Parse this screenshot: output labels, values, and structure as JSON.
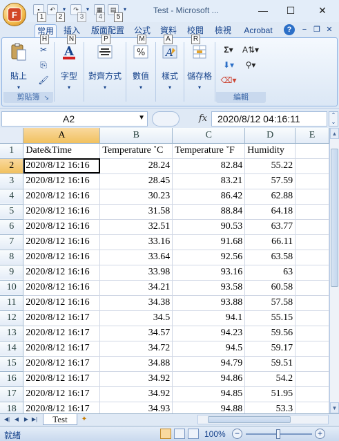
{
  "window": {
    "title": "Test - Microsoft ...",
    "office_button_letter": "F",
    "minimize": "—",
    "maximize": "☐",
    "close": "✕"
  },
  "qat_keytips": [
    "1",
    "2",
    "3",
    "4",
    "5"
  ],
  "ribbon_tabs": [
    {
      "label": "常用",
      "keytip": "H",
      "active": true
    },
    {
      "label": "插入",
      "keytip": "N",
      "active": false
    },
    {
      "label": "版面配置",
      "keytip": "P",
      "active": false
    },
    {
      "label": "公式",
      "keytip": "M",
      "active": false
    },
    {
      "label": "資料",
      "keytip": "A",
      "active": false
    },
    {
      "label": "校閱",
      "keytip": "R",
      "active": false
    },
    {
      "label": "檢視",
      "keytip": "",
      "active": false
    },
    {
      "label": "Acrobat",
      "keytip": "",
      "active": false
    }
  ],
  "ribbon": {
    "groups": {
      "clipboard": {
        "label": "剪貼簿",
        "paste_label": "貼上"
      },
      "font": {
        "label": "字型"
      },
      "alignment": {
        "label": "對齊方式"
      },
      "number": {
        "label": "數值"
      },
      "styles": {
        "label": "樣式"
      },
      "cells": {
        "label": "儲存格"
      },
      "editing": {
        "label": "編輯"
      }
    }
  },
  "formula_bar": {
    "name_box": "A2",
    "fx": "fx",
    "formula": "2020/8/12  04:16:11"
  },
  "sheet": {
    "col_headers": [
      "A",
      "B",
      "C",
      "D",
      "E"
    ],
    "selected_col": "A",
    "selected_row": 2,
    "rows": [
      {
        "n": 1,
        "cells": [
          "Date&Time",
          "Temperature ˚C",
          "Temperature ˚F",
          "Humidity",
          ""
        ]
      },
      {
        "n": 2,
        "cells": [
          "2020/8/12 16:16",
          "28.24",
          "82.84",
          "55.22",
          ""
        ]
      },
      {
        "n": 3,
        "cells": [
          "2020/8/12 16:16",
          "28.45",
          "83.21",
          "57.59",
          ""
        ]
      },
      {
        "n": 4,
        "cells": [
          "2020/8/12 16:16",
          "30.23",
          "86.42",
          "62.88",
          ""
        ]
      },
      {
        "n": 5,
        "cells": [
          "2020/8/12 16:16",
          "31.58",
          "88.84",
          "64.18",
          ""
        ]
      },
      {
        "n": 6,
        "cells": [
          "2020/8/12 16:16",
          "32.51",
          "90.53",
          "63.77",
          ""
        ]
      },
      {
        "n": 7,
        "cells": [
          "2020/8/12 16:16",
          "33.16",
          "91.68",
          "66.11",
          ""
        ]
      },
      {
        "n": 8,
        "cells": [
          "2020/8/12 16:16",
          "33.64",
          "92.56",
          "63.58",
          ""
        ]
      },
      {
        "n": 9,
        "cells": [
          "2020/8/12 16:16",
          "33.98",
          "93.16",
          "63",
          ""
        ]
      },
      {
        "n": 10,
        "cells": [
          "2020/8/12 16:16",
          "34.21",
          "93.58",
          "60.58",
          ""
        ]
      },
      {
        "n": 11,
        "cells": [
          "2020/8/12 16:16",
          "34.38",
          "93.88",
          "57.58",
          ""
        ]
      },
      {
        "n": 12,
        "cells": [
          "2020/8/12 16:17",
          "34.5",
          "94.1",
          "55.15",
          ""
        ]
      },
      {
        "n": 13,
        "cells": [
          "2020/8/12 16:17",
          "34.57",
          "94.23",
          "59.56",
          ""
        ]
      },
      {
        "n": 14,
        "cells": [
          "2020/8/12 16:17",
          "34.72",
          "94.5",
          "59.17",
          ""
        ]
      },
      {
        "n": 15,
        "cells": [
          "2020/8/12 16:17",
          "34.88",
          "94.79",
          "59.51",
          ""
        ]
      },
      {
        "n": 16,
        "cells": [
          "2020/8/12 16:17",
          "34.92",
          "94.86",
          "54.2",
          ""
        ]
      },
      {
        "n": 17,
        "cells": [
          "2020/8/12 16:17",
          "34.92",
          "94.85",
          "51.95",
          ""
        ]
      },
      {
        "n": 18,
        "cells": [
          "2020/8/12 16:17",
          "34.93",
          "94.88",
          "53.3",
          ""
        ]
      }
    ]
  },
  "sheet_tabs": {
    "active": "Test"
  },
  "status_bar": {
    "mode": "就緒",
    "zoom": "100%",
    "zoom_minus": "−",
    "zoom_plus": "+"
  },
  "colors": {
    "ribbon_text": "#15428b",
    "selected_header": "#f1c15f",
    "grid_line": "#d0d7e5"
  }
}
